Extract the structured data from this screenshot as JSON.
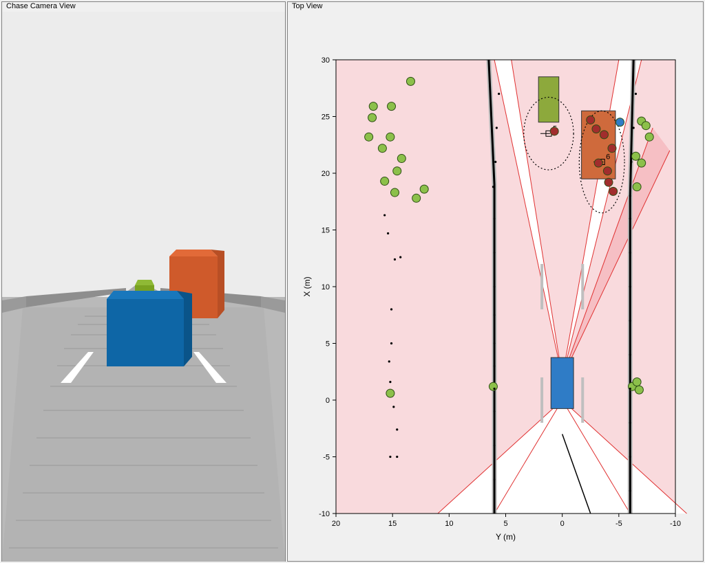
{
  "left_panel": {
    "title": "Chase Camera View"
  },
  "right_panel": {
    "title": "Top View"
  },
  "chart_data": {
    "type": "scatter",
    "title": "",
    "xlabel": "Y (m)",
    "ylabel": "X (m)",
    "xlim": [
      20,
      -10
    ],
    "ylim": [
      -10,
      30
    ],
    "x_ticks": [
      20,
      15,
      10,
      5,
      0,
      -5,
      -10
    ],
    "y_ticks": [
      -10,
      -5,
      0,
      5,
      10,
      15,
      20,
      25,
      30
    ],
    "vehicles": [
      {
        "name": "ego",
        "color": "#2f7cc6",
        "x": 1.5,
        "y": 0,
        "w": 2,
        "h": 4.5
      },
      {
        "name": "target1",
        "color": "#8da93c",
        "x": 26.5,
        "y": 1.2,
        "w": 1.8,
        "h": 4
      },
      {
        "name": "target2",
        "color": "#cf6a3c",
        "x": 22.5,
        "y": -3.2,
        "w": 3,
        "h": 6
      }
    ],
    "lane_markers": [
      {
        "y": 1.8,
        "x1": -2,
        "x2": 2
      },
      {
        "y": 1.8,
        "x1": 8,
        "x2": 12
      },
      {
        "y": -1.8,
        "x1": -2,
        "x2": 2
      },
      {
        "y": -1.8,
        "x1": 8,
        "x2": 12
      }
    ],
    "scan_rays": [
      [
        [
          0,
          2
        ],
        [
          6,
          30
        ]
      ],
      [
        [
          0,
          2
        ],
        [
          4.5,
          30
        ]
      ],
      [
        [
          0,
          2
        ],
        [
          -5,
          30
        ]
      ],
      [
        [
          0,
          2
        ],
        [
          -7,
          30
        ]
      ],
      [
        [
          0,
          2
        ],
        [
          -8,
          24
        ]
      ],
      [
        [
          0,
          2
        ],
        [
          -9.5,
          22
        ]
      ],
      [
        [
          0,
          0
        ],
        [
          6,
          -10
        ]
      ],
      [
        [
          0,
          0
        ],
        [
          -6,
          -10
        ]
      ],
      [
        [
          0,
          0
        ],
        [
          11,
          -10
        ]
      ],
      [
        [
          0,
          0
        ],
        [
          -11,
          -10
        ]
      ]
    ],
    "barriers": [
      [
        [
          6,
          -10
        ],
        [
          6,
          19
        ],
        [
          6.5,
          30
        ]
      ],
      [
        [
          -6,
          -10
        ],
        [
          -6,
          18
        ],
        [
          -6.3,
          30
        ]
      ]
    ],
    "tracks": [
      {
        "id": "5",
        "y": 1.2,
        "x": 23.5,
        "ea": 2.2,
        "eb": 3.2
      },
      {
        "id": "6",
        "y": -3.5,
        "x": 21.0,
        "ea": 2.0,
        "eb": 4.5
      }
    ],
    "series": [
      {
        "name": "green-dots",
        "color": "#8cc04a",
        "r": 6,
        "points": [
          [
            16.7,
            25.9
          ],
          [
            15.1,
            25.9
          ],
          [
            16.8,
            24.9
          ],
          [
            17.1,
            23.2
          ],
          [
            15.2,
            23.2
          ],
          [
            15.9,
            22.2
          ],
          [
            14.2,
            21.3
          ],
          [
            14.6,
            20.2
          ],
          [
            15.7,
            19.3
          ],
          [
            14.8,
            18.3
          ],
          [
            12.2,
            18.6
          ],
          [
            12.9,
            17.8
          ],
          [
            13.4,
            28.1
          ],
          [
            15.2,
            0.6
          ],
          [
            6.1,
            1.2
          ],
          [
            -6.2,
            1.2
          ],
          [
            -6.6,
            1.6
          ],
          [
            -6.8,
            0.9
          ],
          [
            -7.0,
            24.6
          ],
          [
            -7.4,
            24.2
          ],
          [
            -7.7,
            23.2
          ],
          [
            -7.0,
            20.9
          ],
          [
            -6.6,
            18.8
          ],
          [
            -6.5,
            21.5
          ]
        ]
      },
      {
        "name": "red-dots",
        "color": "#a12d2d",
        "r": 6,
        "points": [
          [
            0.7,
            23.7
          ],
          [
            -2.5,
            24.7
          ],
          [
            -3.0,
            23.9
          ],
          [
            -3.7,
            23.4
          ],
          [
            -4.4,
            22.2
          ],
          [
            -3.2,
            20.9
          ],
          [
            -4.0,
            20.2
          ],
          [
            -4.5,
            18.4
          ],
          [
            -4.1,
            19.2
          ]
        ]
      },
      {
        "name": "blue-dot",
        "color": "#2f7cc6",
        "r": 6,
        "points": [
          [
            -5.1,
            24.5
          ]
        ]
      },
      {
        "name": "black-small",
        "color": "#000",
        "r": 1.6,
        "points": [
          [
            15.7,
            16.3
          ],
          [
            15.4,
            14.7
          ],
          [
            14.3,
            12.6
          ],
          [
            14.8,
            12.4
          ],
          [
            15.1,
            8.0
          ],
          [
            15.1,
            5.0
          ],
          [
            15.3,
            3.4
          ],
          [
            15.2,
            1.6
          ],
          [
            14.9,
            -0.6
          ],
          [
            14.6,
            -2.6
          ],
          [
            15.2,
            -5.0
          ],
          [
            14.6,
            -5.0
          ],
          [
            6.1,
            18.8
          ],
          [
            6,
            16
          ],
          [
            6,
            13
          ],
          [
            6,
            10
          ],
          [
            6,
            7.5
          ],
          [
            6,
            5
          ],
          [
            6,
            3
          ],
          [
            6,
            1
          ],
          [
            6,
            -1
          ],
          [
            6,
            -4
          ],
          [
            6,
            -7
          ],
          [
            5.9,
            21
          ],
          [
            5.8,
            24
          ],
          [
            5.6,
            27
          ],
          [
            -6,
            -8
          ],
          [
            -6,
            -5
          ],
          [
            -6,
            -2
          ],
          [
            -6,
            1
          ],
          [
            -6,
            4
          ],
          [
            -6,
            7
          ],
          [
            -6,
            10
          ],
          [
            -6,
            13
          ],
          [
            -6,
            16
          ],
          [
            -6,
            18
          ],
          [
            -6.1,
            21
          ],
          [
            -6.3,
            24
          ],
          [
            -6.5,
            27
          ]
        ]
      }
    ]
  }
}
